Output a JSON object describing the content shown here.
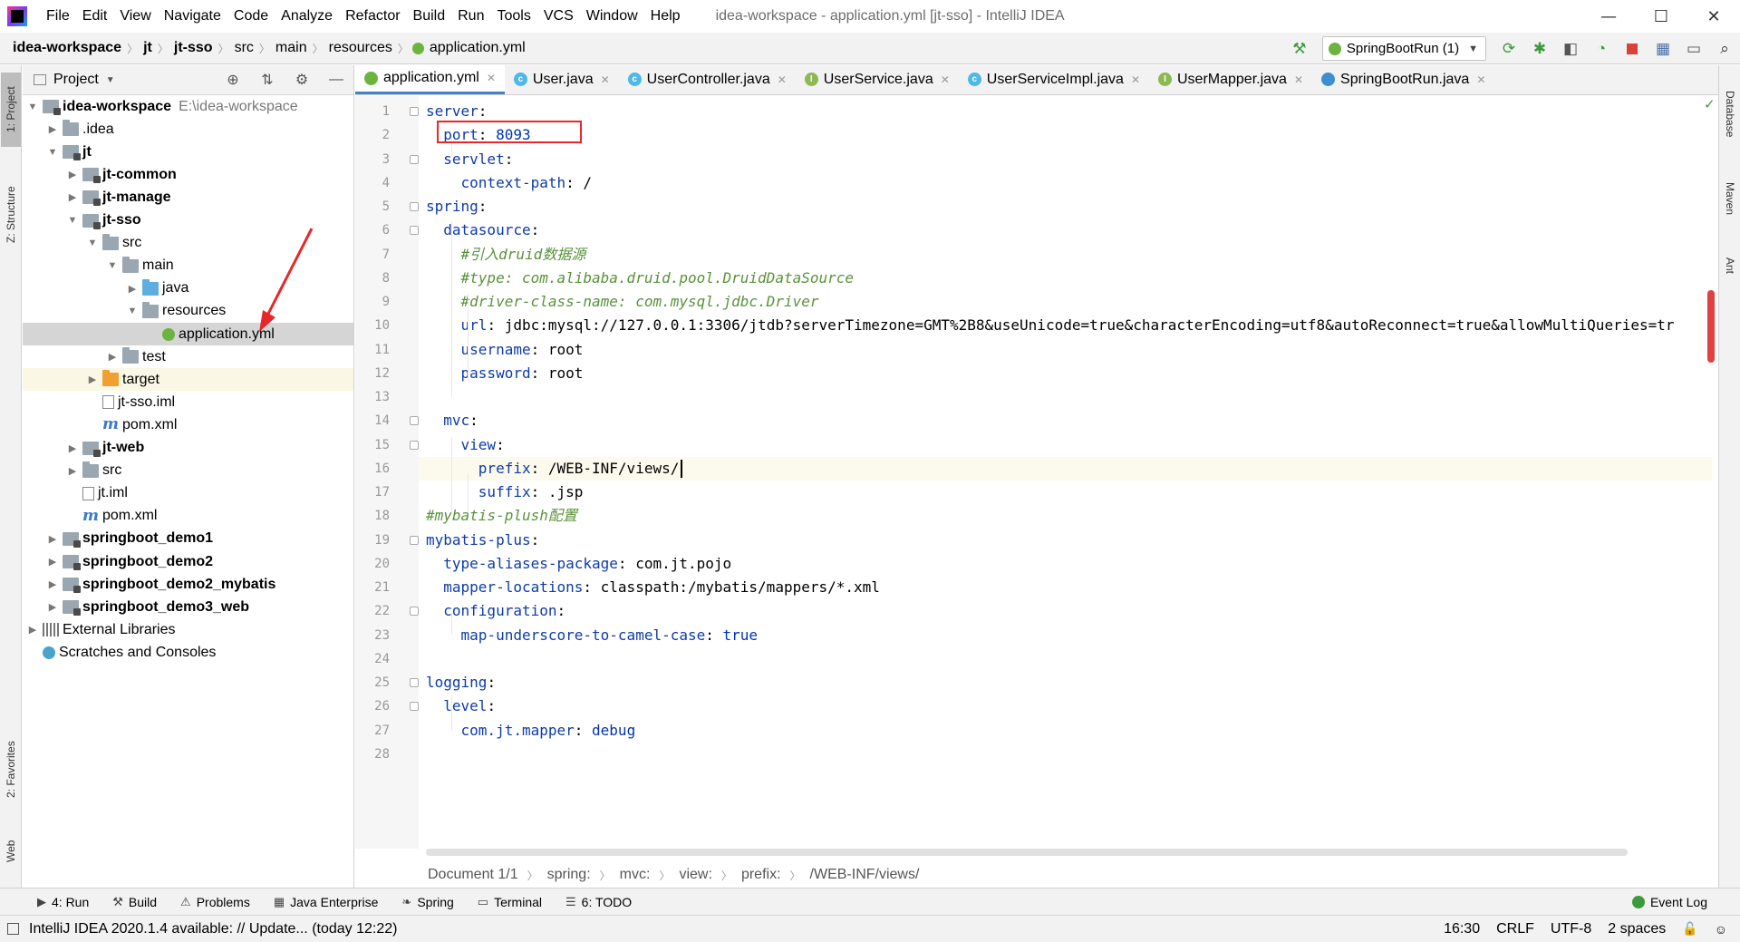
{
  "app": {
    "window_title": "idea-workspace - application.yml [jt-sso] - IntelliJ IDEA",
    "menu": [
      "File",
      "Edit",
      "View",
      "Navigate",
      "Code",
      "Analyze",
      "Refactor",
      "Build",
      "Run",
      "Tools",
      "VCS",
      "Window",
      "Help"
    ],
    "window_controls": {
      "minimize": "—",
      "maximize": "☐",
      "close": "✕"
    }
  },
  "navbar": {
    "crumbs": [
      "idea-workspace",
      "jt",
      "jt-sso",
      "src",
      "main",
      "resources",
      "application.yml"
    ],
    "run_config": "SpringBootRun (1)"
  },
  "left_stripe": {
    "project_tab": "1: Project",
    "structure_tab": "Z: Structure",
    "favorites_tab": "2: Favorites",
    "web_tab": "Web"
  },
  "right_stripe": {
    "database_tab": "Database",
    "maven_tab": "Maven",
    "ant_tab": "Ant"
  },
  "project_panel": {
    "title": "Project",
    "tree": [
      {
        "label": "idea-workspace",
        "path": "E:\\idea-workspace",
        "depth": 0,
        "arrow": "▼",
        "icon": "module",
        "bold": true
      },
      {
        "label": ".idea",
        "depth": 1,
        "arrow": "▶",
        "icon": "folder"
      },
      {
        "label": "jt",
        "depth": 1,
        "arrow": "▼",
        "icon": "module",
        "bold": true
      },
      {
        "label": "jt-common",
        "depth": 2,
        "arrow": "▶",
        "icon": "module",
        "bold": true
      },
      {
        "label": "jt-manage",
        "depth": 2,
        "arrow": "▶",
        "icon": "module",
        "bold": true
      },
      {
        "label": "jt-sso",
        "depth": 2,
        "arrow": "▼",
        "icon": "module",
        "bold": true
      },
      {
        "label": "src",
        "depth": 3,
        "arrow": "▼",
        "icon": "folder"
      },
      {
        "label": "main",
        "depth": 4,
        "arrow": "▼",
        "icon": "folder"
      },
      {
        "label": "java",
        "depth": 5,
        "arrow": "▶",
        "icon": "blue"
      },
      {
        "label": "resources",
        "depth": 5,
        "arrow": "▼",
        "icon": "res"
      },
      {
        "label": "application.yml",
        "depth": 6,
        "arrow": "",
        "icon": "yml",
        "selected": true
      },
      {
        "label": "test",
        "depth": 4,
        "arrow": "▶",
        "icon": "folder"
      },
      {
        "label": "target",
        "depth": 3,
        "arrow": "▶",
        "icon": "orange",
        "excluded": true
      },
      {
        "label": "jt-sso.iml",
        "depth": 3,
        "arrow": "",
        "icon": "file"
      },
      {
        "label": "pom.xml",
        "depth": 3,
        "arrow": "",
        "icon": "mvn"
      },
      {
        "label": "jt-web",
        "depth": 2,
        "arrow": "▶",
        "icon": "module",
        "bold": true
      },
      {
        "label": "src",
        "depth": 2,
        "arrow": "▶",
        "icon": "folder"
      },
      {
        "label": "jt.iml",
        "depth": 2,
        "arrow": "",
        "icon": "file"
      },
      {
        "label": "pom.xml",
        "depth": 2,
        "arrow": "",
        "icon": "mvn"
      },
      {
        "label": "springboot_demo1",
        "depth": 1,
        "arrow": "▶",
        "icon": "module",
        "bold": true
      },
      {
        "label": "springboot_demo2",
        "depth": 1,
        "arrow": "▶",
        "icon": "module",
        "bold": true
      },
      {
        "label": "springboot_demo2_mybatis",
        "depth": 1,
        "arrow": "▶",
        "icon": "module",
        "bold": true
      },
      {
        "label": "springboot_demo3_web",
        "depth": 1,
        "arrow": "▶",
        "icon": "module",
        "bold": true
      },
      {
        "label": "External Libraries",
        "depth": 0,
        "arrow": "▶",
        "icon": "libs"
      },
      {
        "label": "Scratches and Consoles",
        "depth": 0,
        "arrow": "",
        "icon": "scratch"
      }
    ]
  },
  "editor": {
    "tabs": [
      {
        "label": "application.yml",
        "icon": "y",
        "active": true
      },
      {
        "label": "User.java",
        "icon": "c"
      },
      {
        "label": "UserController.java",
        "icon": "c"
      },
      {
        "label": "UserService.java",
        "icon": "i"
      },
      {
        "label": "UserServiceImpl.java",
        "icon": "c"
      },
      {
        "label": "UserMapper.java",
        "icon": "i"
      },
      {
        "label": "SpringBootRun.java",
        "icon": "s"
      }
    ],
    "lines": [
      {
        "n": "1",
        "segs": [
          [
            "k",
            "server"
          ],
          [
            "v",
            ":"
          ]
        ]
      },
      {
        "n": "2",
        "segs": [
          [
            "v",
            "  "
          ],
          [
            "k",
            "port"
          ],
          [
            "v",
            ": "
          ],
          [
            "vb",
            "8093"
          ]
        ]
      },
      {
        "n": "3",
        "segs": [
          [
            "v",
            "  "
          ],
          [
            "k",
            "servlet"
          ],
          [
            "v",
            ":"
          ]
        ]
      },
      {
        "n": "4",
        "segs": [
          [
            "v",
            "    "
          ],
          [
            "k",
            "context-path"
          ],
          [
            "v",
            ": /"
          ]
        ]
      },
      {
        "n": "5",
        "segs": [
          [
            "k",
            "spring"
          ],
          [
            "v",
            ":"
          ]
        ]
      },
      {
        "n": "6",
        "segs": [
          [
            "v",
            "  "
          ],
          [
            "k",
            "datasource"
          ],
          [
            "v",
            ":"
          ]
        ]
      },
      {
        "n": "7",
        "segs": [
          [
            "v",
            "    "
          ],
          [
            "cm",
            "#引入druid数据源"
          ]
        ]
      },
      {
        "n": "8",
        "segs": [
          [
            "v",
            "    "
          ],
          [
            "cm",
            "#type: com.alibaba.druid.pool.DruidDataSource"
          ]
        ]
      },
      {
        "n": "9",
        "segs": [
          [
            "v",
            "    "
          ],
          [
            "cm",
            "#driver-class-name: com.mysql.jdbc.Driver"
          ]
        ]
      },
      {
        "n": "10",
        "segs": [
          [
            "v",
            "    "
          ],
          [
            "k",
            "url"
          ],
          [
            "v",
            ": jdbc:mysql://127.0.0.1:3306/jtdb?serverTimezone=GMT%2B8&useUnicode=true&characterEncoding=utf8&autoReconnect=true&allowMultiQueries=tr"
          ]
        ]
      },
      {
        "n": "11",
        "segs": [
          [
            "v",
            "    "
          ],
          [
            "k",
            "username"
          ],
          [
            "v",
            ": root"
          ]
        ]
      },
      {
        "n": "12",
        "segs": [
          [
            "v",
            "    "
          ],
          [
            "k",
            "password"
          ],
          [
            "v",
            ": root"
          ]
        ]
      },
      {
        "n": "13",
        "segs": []
      },
      {
        "n": "14",
        "segs": [
          [
            "v",
            "  "
          ],
          [
            "k",
            "mvc"
          ],
          [
            "v",
            ":"
          ]
        ]
      },
      {
        "n": "15",
        "segs": [
          [
            "v",
            "    "
          ],
          [
            "k",
            "view"
          ],
          [
            "v",
            ":"
          ]
        ]
      },
      {
        "n": "16",
        "segs": [
          [
            "v",
            "      "
          ],
          [
            "k",
            "prefix"
          ],
          [
            "v",
            ": /WEB-INF/views/"
          ]
        ]
      },
      {
        "n": "17",
        "segs": [
          [
            "v",
            "      "
          ],
          [
            "k",
            "suffix"
          ],
          [
            "v",
            ": .jsp"
          ]
        ]
      },
      {
        "n": "18",
        "segs": [
          [
            "cm",
            "#mybatis-plush配置"
          ]
        ]
      },
      {
        "n": "19",
        "segs": [
          [
            "k",
            "mybatis-plus"
          ],
          [
            "v",
            ":"
          ]
        ]
      },
      {
        "n": "20",
        "segs": [
          [
            "v",
            "  "
          ],
          [
            "k",
            "type-aliases-package"
          ],
          [
            "v",
            ": com.jt.pojo"
          ]
        ]
      },
      {
        "n": "21",
        "segs": [
          [
            "v",
            "  "
          ],
          [
            "k",
            "mapper-locations"
          ],
          [
            "v",
            ": classpath:/mybatis/mappers/*.xml"
          ]
        ]
      },
      {
        "n": "22",
        "segs": [
          [
            "v",
            "  "
          ],
          [
            "k",
            "configuration"
          ],
          [
            "v",
            ":"
          ]
        ]
      },
      {
        "n": "23",
        "segs": [
          [
            "v",
            "    "
          ],
          [
            "k",
            "map-underscore-to-camel-case"
          ],
          [
            "v",
            ": "
          ],
          [
            "vb",
            "true"
          ]
        ]
      },
      {
        "n": "24",
        "segs": []
      },
      {
        "n": "25",
        "segs": [
          [
            "k",
            "logging"
          ],
          [
            "v",
            ":"
          ]
        ]
      },
      {
        "n": "26",
        "segs": [
          [
            "v",
            "  "
          ],
          [
            "k",
            "level"
          ],
          [
            "v",
            ":"
          ]
        ]
      },
      {
        "n": "27",
        "segs": [
          [
            "v",
            "    "
          ],
          [
            "k",
            "com.jt.mapper"
          ],
          [
            "v",
            ": "
          ],
          [
            "vb",
            "debug"
          ]
        ]
      },
      {
        "n": "28",
        "segs": []
      }
    ],
    "breadcrumb": [
      "Document 1/1",
      "spring:",
      "mvc:",
      "view:",
      "prefix:",
      "/WEB-INF/views/"
    ]
  },
  "bottom_tools": [
    {
      "label": "4: Run",
      "icon": "run-icon"
    },
    {
      "label": "Build",
      "icon": "build-icon"
    },
    {
      "label": "Problems",
      "icon": "warning-icon"
    },
    {
      "label": "Java Enterprise",
      "icon": "java-enterprise-icon"
    },
    {
      "label": "Spring",
      "icon": "spring-icon"
    },
    {
      "label": "Terminal",
      "icon": "terminal-icon"
    },
    {
      "label": "6: TODO",
      "icon": "todo-icon"
    }
  ],
  "event_log": "Event Log",
  "status": {
    "message": "IntelliJ IDEA 2020.1.4 available: // Update... (today 12:22)",
    "position": "16:30",
    "line_sep": "CRLF",
    "encoding": "UTF-8",
    "indent": "2 spaces"
  },
  "colors": {
    "accent": "#4083c9",
    "highlight_box": "#e8262b",
    "yaml_key": "#0d3ba8",
    "comment": "#59923b"
  }
}
